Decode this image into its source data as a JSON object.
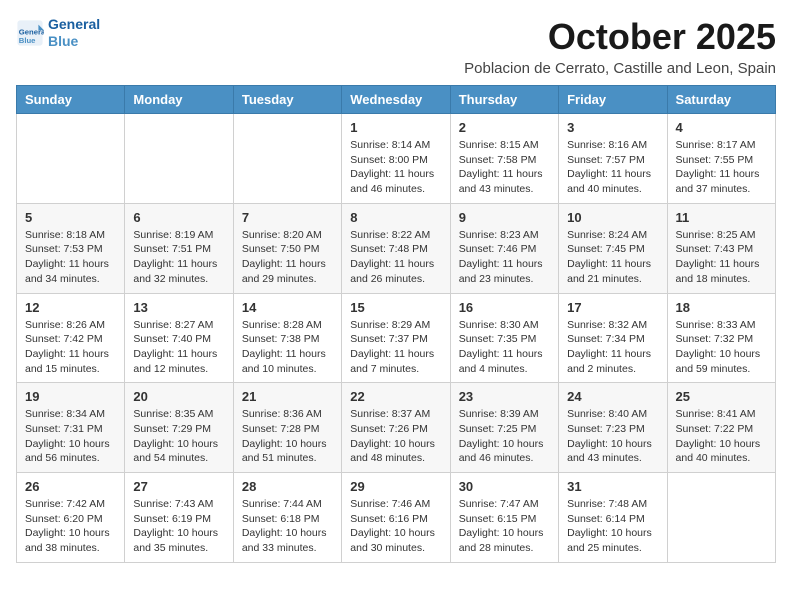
{
  "logo": {
    "line1": "General",
    "line2": "Blue"
  },
  "title": "October 2025",
  "location": "Poblacion de Cerrato, Castille and Leon, Spain",
  "days_of_week": [
    "Sunday",
    "Monday",
    "Tuesday",
    "Wednesday",
    "Thursday",
    "Friday",
    "Saturday"
  ],
  "weeks": [
    [
      {
        "day": "",
        "info": ""
      },
      {
        "day": "",
        "info": ""
      },
      {
        "day": "",
        "info": ""
      },
      {
        "day": "1",
        "info": "Sunrise: 8:14 AM\nSunset: 8:00 PM\nDaylight: 11 hours and 46 minutes."
      },
      {
        "day": "2",
        "info": "Sunrise: 8:15 AM\nSunset: 7:58 PM\nDaylight: 11 hours and 43 minutes."
      },
      {
        "day": "3",
        "info": "Sunrise: 8:16 AM\nSunset: 7:57 PM\nDaylight: 11 hours and 40 minutes."
      },
      {
        "day": "4",
        "info": "Sunrise: 8:17 AM\nSunset: 7:55 PM\nDaylight: 11 hours and 37 minutes."
      }
    ],
    [
      {
        "day": "5",
        "info": "Sunrise: 8:18 AM\nSunset: 7:53 PM\nDaylight: 11 hours and 34 minutes."
      },
      {
        "day": "6",
        "info": "Sunrise: 8:19 AM\nSunset: 7:51 PM\nDaylight: 11 hours and 32 minutes."
      },
      {
        "day": "7",
        "info": "Sunrise: 8:20 AM\nSunset: 7:50 PM\nDaylight: 11 hours and 29 minutes."
      },
      {
        "day": "8",
        "info": "Sunrise: 8:22 AM\nSunset: 7:48 PM\nDaylight: 11 hours and 26 minutes."
      },
      {
        "day": "9",
        "info": "Sunrise: 8:23 AM\nSunset: 7:46 PM\nDaylight: 11 hours and 23 minutes."
      },
      {
        "day": "10",
        "info": "Sunrise: 8:24 AM\nSunset: 7:45 PM\nDaylight: 11 hours and 21 minutes."
      },
      {
        "day": "11",
        "info": "Sunrise: 8:25 AM\nSunset: 7:43 PM\nDaylight: 11 hours and 18 minutes."
      }
    ],
    [
      {
        "day": "12",
        "info": "Sunrise: 8:26 AM\nSunset: 7:42 PM\nDaylight: 11 hours and 15 minutes."
      },
      {
        "day": "13",
        "info": "Sunrise: 8:27 AM\nSunset: 7:40 PM\nDaylight: 11 hours and 12 minutes."
      },
      {
        "day": "14",
        "info": "Sunrise: 8:28 AM\nSunset: 7:38 PM\nDaylight: 11 hours and 10 minutes."
      },
      {
        "day": "15",
        "info": "Sunrise: 8:29 AM\nSunset: 7:37 PM\nDaylight: 11 hours and 7 minutes."
      },
      {
        "day": "16",
        "info": "Sunrise: 8:30 AM\nSunset: 7:35 PM\nDaylight: 11 hours and 4 minutes."
      },
      {
        "day": "17",
        "info": "Sunrise: 8:32 AM\nSunset: 7:34 PM\nDaylight: 11 hours and 2 minutes."
      },
      {
        "day": "18",
        "info": "Sunrise: 8:33 AM\nSunset: 7:32 PM\nDaylight: 10 hours and 59 minutes."
      }
    ],
    [
      {
        "day": "19",
        "info": "Sunrise: 8:34 AM\nSunset: 7:31 PM\nDaylight: 10 hours and 56 minutes."
      },
      {
        "day": "20",
        "info": "Sunrise: 8:35 AM\nSunset: 7:29 PM\nDaylight: 10 hours and 54 minutes."
      },
      {
        "day": "21",
        "info": "Sunrise: 8:36 AM\nSunset: 7:28 PM\nDaylight: 10 hours and 51 minutes."
      },
      {
        "day": "22",
        "info": "Sunrise: 8:37 AM\nSunset: 7:26 PM\nDaylight: 10 hours and 48 minutes."
      },
      {
        "day": "23",
        "info": "Sunrise: 8:39 AM\nSunset: 7:25 PM\nDaylight: 10 hours and 46 minutes."
      },
      {
        "day": "24",
        "info": "Sunrise: 8:40 AM\nSunset: 7:23 PM\nDaylight: 10 hours and 43 minutes."
      },
      {
        "day": "25",
        "info": "Sunrise: 8:41 AM\nSunset: 7:22 PM\nDaylight: 10 hours and 40 minutes."
      }
    ],
    [
      {
        "day": "26",
        "info": "Sunrise: 7:42 AM\nSunset: 6:20 PM\nDaylight: 10 hours and 38 minutes."
      },
      {
        "day": "27",
        "info": "Sunrise: 7:43 AM\nSunset: 6:19 PM\nDaylight: 10 hours and 35 minutes."
      },
      {
        "day": "28",
        "info": "Sunrise: 7:44 AM\nSunset: 6:18 PM\nDaylight: 10 hours and 33 minutes."
      },
      {
        "day": "29",
        "info": "Sunrise: 7:46 AM\nSunset: 6:16 PM\nDaylight: 10 hours and 30 minutes."
      },
      {
        "day": "30",
        "info": "Sunrise: 7:47 AM\nSunset: 6:15 PM\nDaylight: 10 hours and 28 minutes."
      },
      {
        "day": "31",
        "info": "Sunrise: 7:48 AM\nSunset: 6:14 PM\nDaylight: 10 hours and 25 minutes."
      },
      {
        "day": "",
        "info": ""
      }
    ]
  ]
}
